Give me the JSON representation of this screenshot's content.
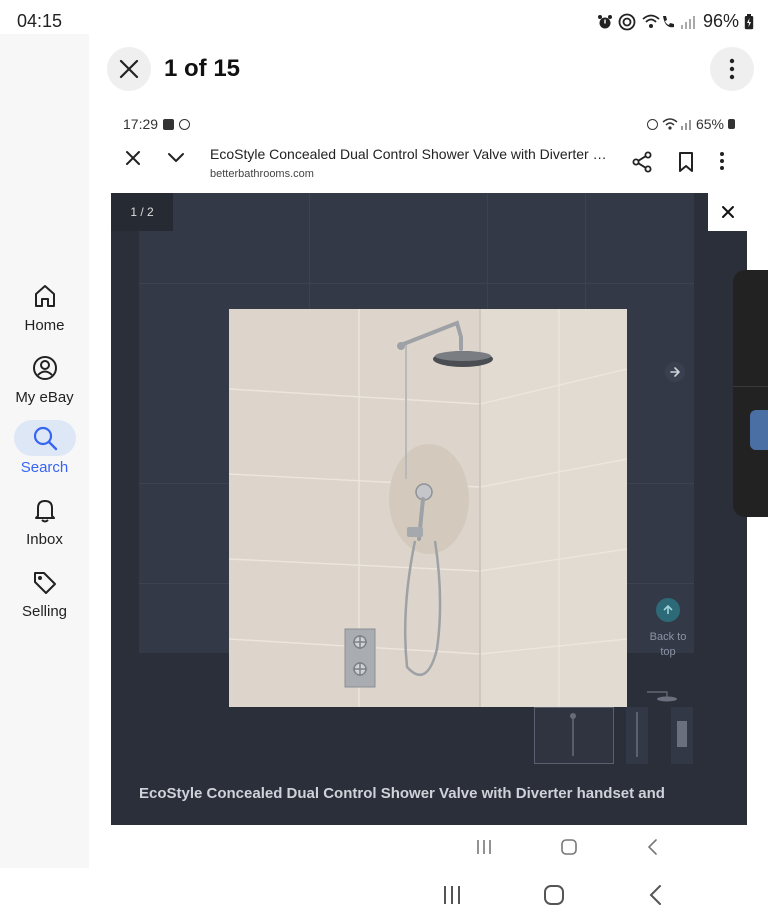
{
  "status_bar": {
    "time": "04:15",
    "battery": "96%",
    "icons": [
      "alarm-icon",
      "nfc-icon",
      "wifi-calling-icon",
      "signal-icon",
      "battery-icon"
    ]
  },
  "sidebar": {
    "items": [
      {
        "label": "Home",
        "icon": "home-icon",
        "active": false
      },
      {
        "label": "My eBay",
        "icon": "user-icon",
        "active": false
      },
      {
        "label": "Search",
        "icon": "search-icon",
        "active": true
      },
      {
        "label": "Inbox",
        "icon": "bell-icon",
        "active": false
      },
      {
        "label": "Selling",
        "icon": "tag-icon",
        "active": false
      }
    ]
  },
  "viewer": {
    "counter": "1 of 15"
  },
  "inner": {
    "status_time": "17:29",
    "battery": "65%",
    "page_title": "EcoStyle Concealed Dual Control Shower Valve with Diverter ha...",
    "domain": "betterbathrooms.com",
    "image_counter": "1 / 2",
    "back_to_top": "Back to top",
    "product_title": "EcoStyle Concealed Dual Control Shower Valve with Diverter handset and"
  },
  "colors": {
    "accent": "#3665f3",
    "active_pill": "#dde7f6",
    "dark_bg": "#2b2f3a",
    "tile": "#ddd5cb"
  }
}
